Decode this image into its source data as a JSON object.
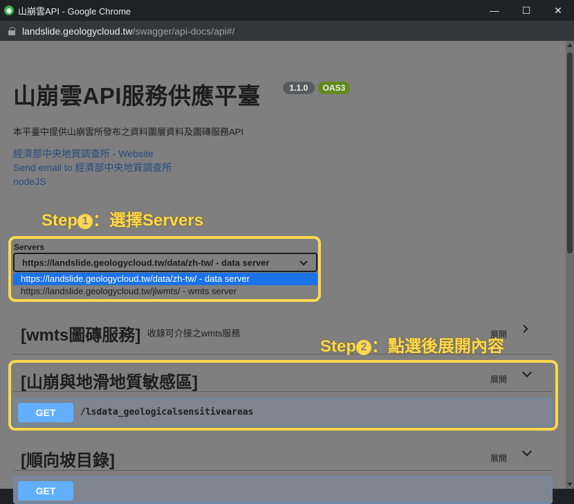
{
  "window": {
    "title": "山崩雲API - Google Chrome",
    "controls": [
      "—",
      "☐",
      "✕"
    ]
  },
  "address_bar": {
    "host": "landslide.geologycloud.tw",
    "path": "/swagger/api-docs/api#/"
  },
  "info": {
    "title": "山崩雲API服務供應平臺",
    "version_badge": "1.1.0",
    "oas_badge": "OAS3",
    "description": "本平臺中提供山崩雲所發布之資料圖層資料及圖磚服務API",
    "links": [
      "經濟部中央地質調查所 - Website",
      "Send email to 經濟部中央地質調查所",
      "nodeJS"
    ]
  },
  "callouts": {
    "step1_prefix": "Step",
    "step1_num": "1",
    "step1_text": "：選擇Servers",
    "step2_prefix": "Step",
    "step2_num": "2",
    "step2_text": "：點選後展開內容"
  },
  "servers": {
    "label": "Servers",
    "selected": "https://landslide.geologycloud.tw/data/zh-tw/ - data server",
    "options": [
      "https://landslide.geologycloud.tw/data/zh-tw/ - data server",
      "https://landslide.geologycloud.tw/jlwmts/ - wmts server"
    ]
  },
  "sections": [
    {
      "title": "[wmts圖磚服務]",
      "subtitle": "收錄可介接之wmts服務",
      "expand_label": "展開"
    },
    {
      "title": "[山崩與地滑地質敏感區]",
      "subtitle": "",
      "expand_label": "展開",
      "operations": [
        {
          "method": "GET",
          "path": "/lsdata_geologicalsensitiveareas"
        }
      ]
    },
    {
      "title": "[順向坡目錄]",
      "subtitle": "",
      "expand_label": "展開",
      "operations": [
        {
          "method": "GET",
          "path": ""
        }
      ]
    }
  ],
  "colors": {
    "accent_callout": "#ffd84d",
    "get_method": "#61affe",
    "select_highlight": "#1a73e8"
  }
}
